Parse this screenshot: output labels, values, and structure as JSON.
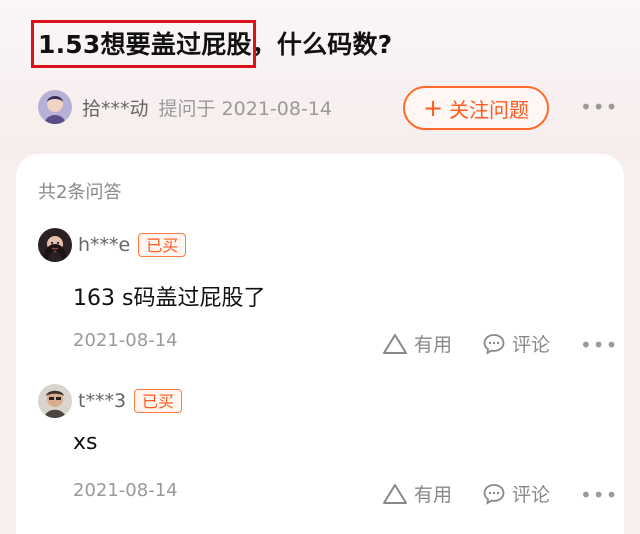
{
  "question": {
    "title": "1.53想要盖过屁股，什么码数?",
    "highlighted_text": "1.53想要盖过屁股",
    "asker": "拾***动",
    "asked_label": "提问于 2021-08-14",
    "follow_label": "关注问题",
    "follow_icon": "plus-icon"
  },
  "answers_header": {
    "count_label": "共2条问答"
  },
  "answers": [
    {
      "user": "h***e",
      "badge": "已买",
      "content": "163 s码盖过屁股了",
      "date": "2021-08-14",
      "useful_label": "有用",
      "comment_label": "评论"
    },
    {
      "user": "t***3",
      "badge": "已买",
      "content": "xs",
      "date": "2021-08-14",
      "useful_label": "有用",
      "comment_label": "评论"
    }
  ],
  "colors": {
    "accent": "#ff5a1f",
    "highlight_box": "#d9121b",
    "background": "#f7eeee"
  }
}
